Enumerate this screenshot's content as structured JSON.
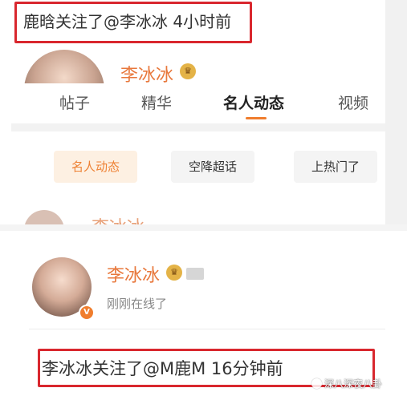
{
  "top": {
    "notice": "鹿晗关注了@李冰冰 4小时前",
    "user_name": "李冰冰",
    "vip_badge_icon": "crown-badge-icon",
    "tabs": [
      {
        "label": "帖子"
      },
      {
        "label": "精华"
      },
      {
        "label": "名人动态"
      },
      {
        "label": "视频"
      }
    ],
    "chips": [
      {
        "label": "名人动态"
      },
      {
        "label": "空降超话"
      },
      {
        "label": "上热门了"
      }
    ],
    "faded_name": "李冰冰"
  },
  "bottom": {
    "user_name": "李冰冰",
    "status": "刚刚在线了",
    "notice": "李冰冰关注了@M鹿M 16分钟前"
  },
  "watermark": "深八深夜八卦",
  "colors": {
    "accent": "#f07d2d",
    "highlight_border": "#d9272e",
    "name_orange": "#e8783c"
  }
}
